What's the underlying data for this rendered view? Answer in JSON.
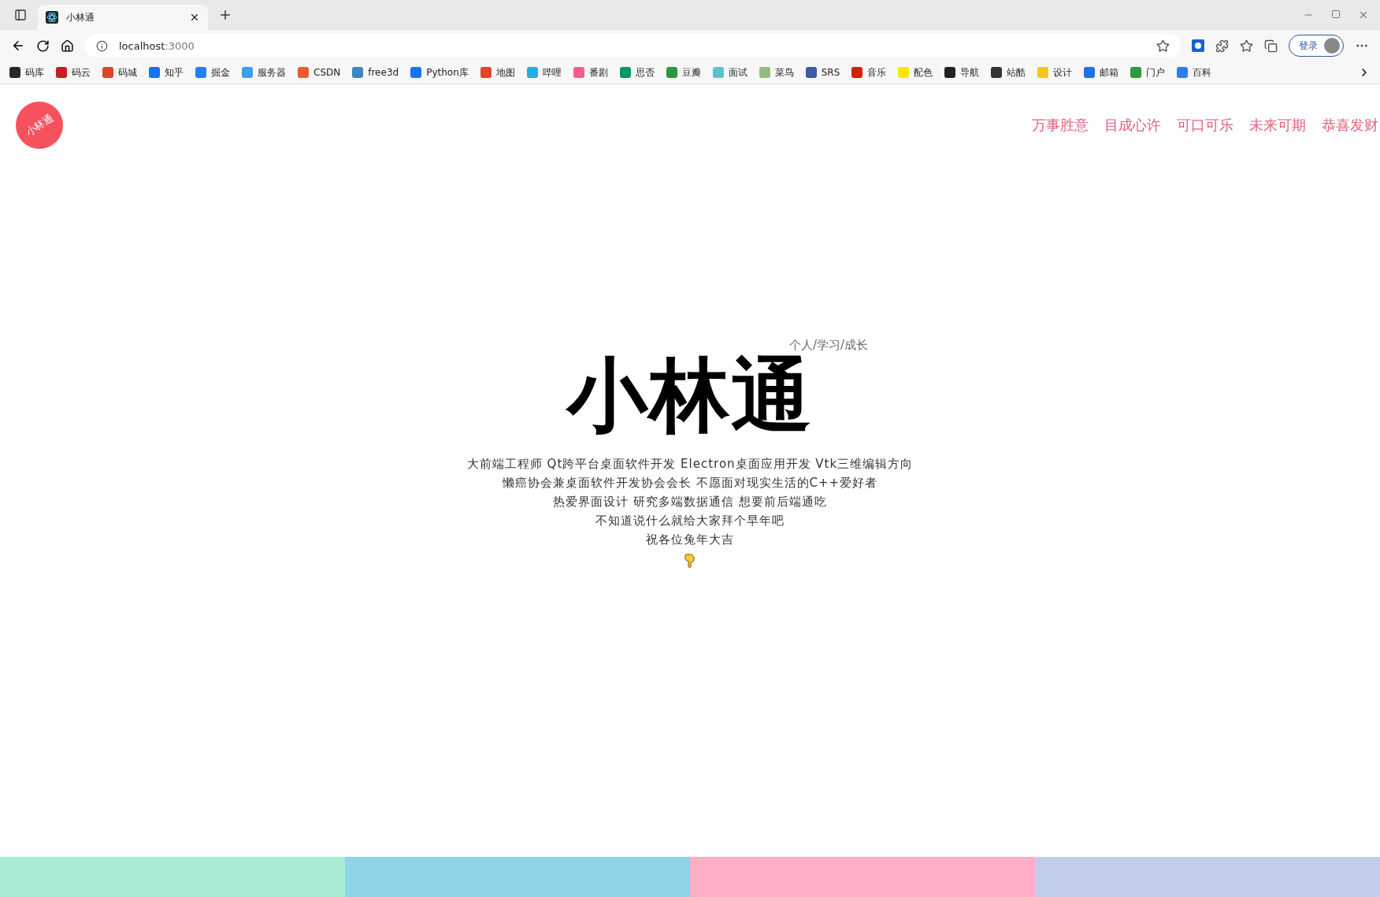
{
  "browser": {
    "tab_title": "小林通",
    "address": "localhost",
    "address_port": ":3000",
    "profile_button": "登录",
    "bookmarks": [
      {
        "label": "码库",
        "color": "#24292e"
      },
      {
        "label": "码云",
        "color": "#c71d23"
      },
      {
        "label": "码城",
        "color": "#e24329"
      },
      {
        "label": "知乎",
        "color": "#1772f6"
      },
      {
        "label": "掘金",
        "color": "#1e80ff"
      },
      {
        "label": "服务器",
        "color": "#3aa0e8"
      },
      {
        "label": "CSDN",
        "color": "#fc5531"
      },
      {
        "label": "free3d",
        "color": "#3d86c6"
      },
      {
        "label": "Python库",
        "color": "#1772f6"
      },
      {
        "label": "地图",
        "color": "#e8412c"
      },
      {
        "label": "哔哩",
        "color": "#23ade5"
      },
      {
        "label": "番剧",
        "color": "#f25d8e"
      },
      {
        "label": "思否",
        "color": "#009a61"
      },
      {
        "label": "豆瓣",
        "color": "#2e963d"
      },
      {
        "label": "面试",
        "color": "#5dc2c6"
      },
      {
        "label": "菜鸟",
        "color": "#96b97d"
      },
      {
        "label": "SRS",
        "color": "#3b5aa8"
      },
      {
        "label": "音乐",
        "color": "#d81e06"
      },
      {
        "label": "配色",
        "color": "#ffe600"
      },
      {
        "label": "导航",
        "color": "#222222"
      },
      {
        "label": "站酷",
        "color": "#333333"
      },
      {
        "label": "设计",
        "color": "#f5c518"
      },
      {
        "label": "邮箱",
        "color": "#1a73e8"
      },
      {
        "label": "门户",
        "color": "#2e9a3a"
      },
      {
        "label": "百科",
        "color": "#2f7ee6"
      }
    ]
  },
  "header": {
    "logo": "小林通",
    "nav": [
      "万事胜意",
      "目成心许",
      "可口可乐",
      "未来可期",
      "恭喜发财"
    ]
  },
  "hero": {
    "tagline": "个人/学习/成长",
    "title": "小林通",
    "lines": [
      "大前端工程师 Qt跨平台桌面软件开发 Electron桌面应用开发 Vtk三维编辑方向",
      "懒癌协会兼桌面软件开发协会会长 不愿面对现实生活的C++爱好者",
      "热爱界面设计 研究多端数据通信 想要前后端通吃",
      "不知道说什么就给大家拜个早年吧",
      "祝各位兔年大吉"
    ]
  },
  "footer_bars": [
    {
      "color": "#a8ecd5"
    },
    {
      "color": "#8fd3e8"
    },
    {
      "color": "#ffafc5"
    },
    {
      "color": "#c1cdea"
    }
  ]
}
